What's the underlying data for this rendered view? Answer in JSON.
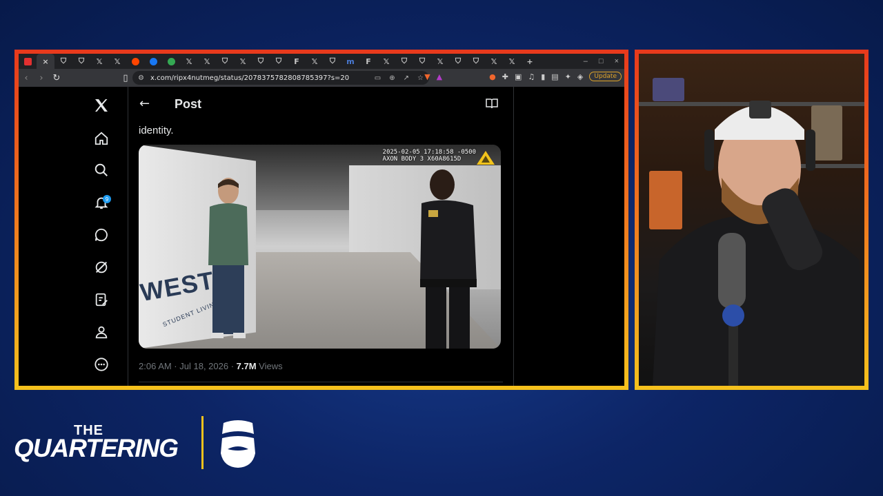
{
  "browser": {
    "tab_icons": [
      "opera-icon",
      "close-icon",
      "shield-icon",
      "shield-icon",
      "x-icon",
      "x-icon",
      "reddit-icon",
      "facebook-icon",
      "google-icon",
      "x-icon",
      "x-icon",
      "shield-icon",
      "x-icon",
      "shield-icon",
      "shield-icon",
      "f-icon",
      "x-icon",
      "shield-icon",
      "m-icon",
      "f-icon",
      "x-icon",
      "shield-icon",
      "shield-icon",
      "x-icon",
      "shield-icon",
      "shield-icon",
      "x-icon",
      "x-icon",
      "plus-icon"
    ],
    "tab_labels": {
      "close": "×",
      "x": "𝕏",
      "f": "F",
      "m": "m",
      "new_tab": "+"
    },
    "url": "x.com/ripx4nutmeg/status/20783757828087853​97?s=20",
    "update_label": "Update",
    "window_controls": [
      "–",
      "□",
      "×"
    ]
  },
  "x": {
    "nav_items": [
      "x-logo",
      "home",
      "search",
      "notifications",
      "messages",
      "grok",
      "lists",
      "profile",
      "more"
    ],
    "notification_count": "9",
    "header": {
      "back": "←",
      "title": "Post"
    },
    "post_text": "identity.",
    "video": {
      "timestamp_line1": "2025-02-05 17:18:58 -0500",
      "timestamp_line2": "AXON BODY 3 X60A8615D",
      "wall_text": "WEST",
      "wall_sub": "STUDENT LIVING"
    },
    "meta": {
      "time_date": "2:06 AM · Jul 18, 2026 · ",
      "views_count": "7.7M",
      "views_label": " Views"
    }
  },
  "brand": {
    "the": "THE",
    "name": "QUARTERING",
    "accent": "#f5c21d"
  },
  "colors": {
    "frame_top": "#e8391c",
    "frame_bottom": "#f5c21d",
    "background": "#0d2566",
    "x_blue": "#1d9bf0"
  }
}
